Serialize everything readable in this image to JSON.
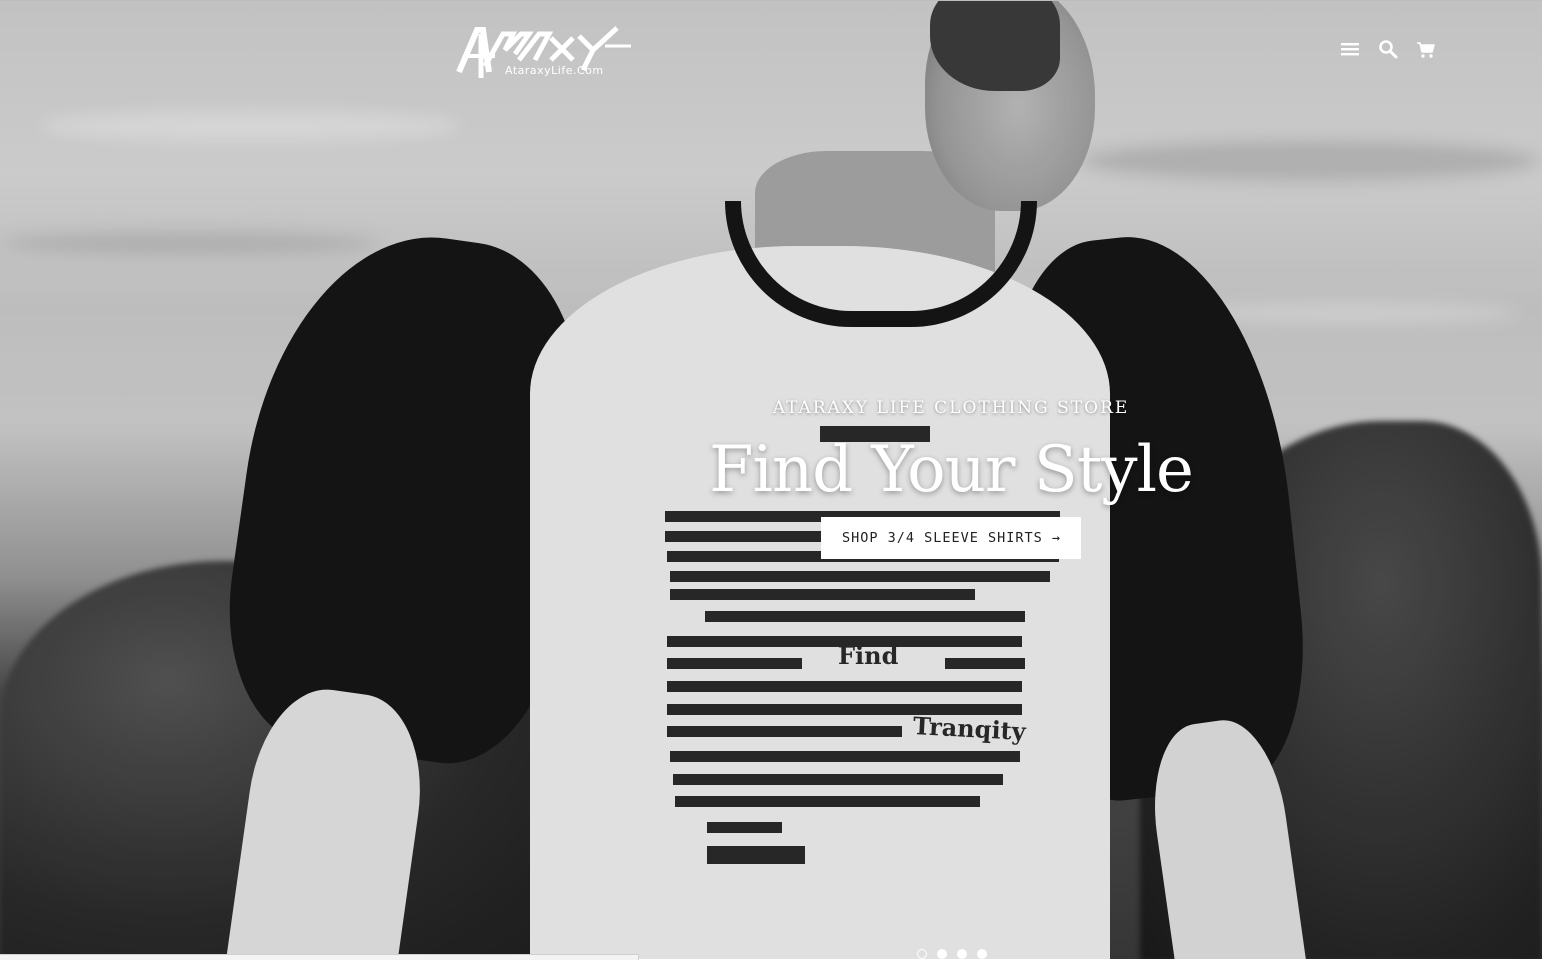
{
  "header": {
    "logo": {
      "mark": "ATARAXY",
      "subtext": "AtaraxyLife.Com"
    },
    "nav_icons": [
      "menu-icon",
      "search-icon",
      "cart-icon"
    ]
  },
  "hero": {
    "kicker": "ATARAXY LIFE CLOTHING STORE",
    "headline": "Find Your Style",
    "cta_label": "SHOP 3/4 SLEEVE SHIRTS →",
    "shirt_print": {
      "word1": "Find",
      "word2": "Tranqity"
    },
    "slides": {
      "count": 4,
      "active": 1
    }
  },
  "colors": {
    "text_on_hero": "#ffffff",
    "button_bg": "#ffffff",
    "button_text": "#222222"
  }
}
